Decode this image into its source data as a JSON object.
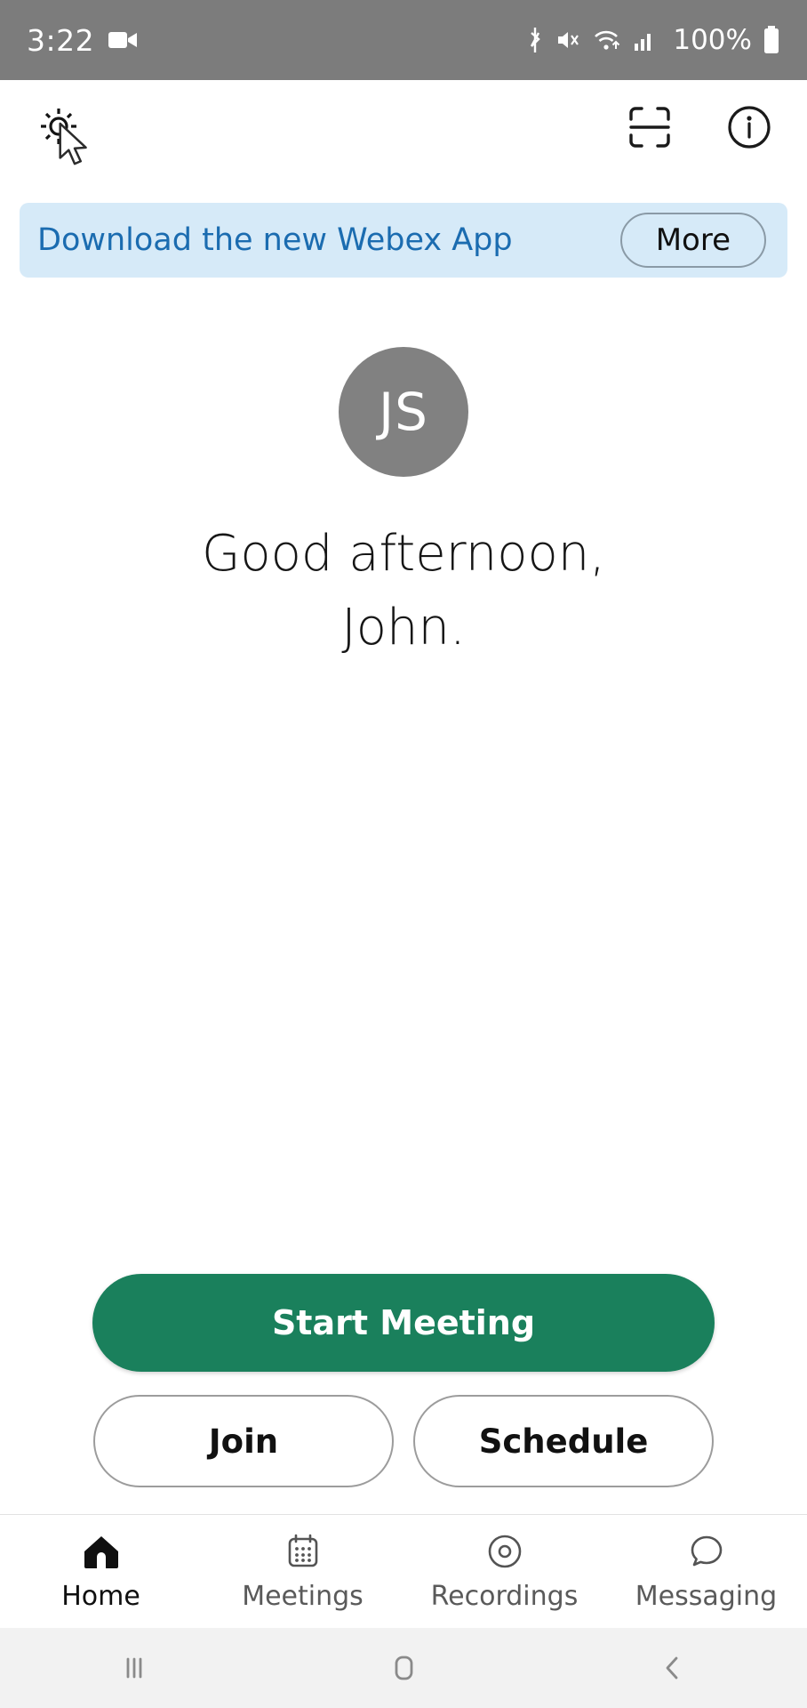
{
  "status_bar": {
    "time": "3:22",
    "battery_text": "100%",
    "icons": [
      "video-camera-icon",
      "bluetooth-icon",
      "mute-icon",
      "wifi-icon",
      "cellular-signal-icon",
      "battery-icon"
    ],
    "background_color": "#7c7c7c"
  },
  "app_bar": {
    "settings_icon": "gear-icon",
    "scan_icon": "qr-scan-icon",
    "info_icon": "info-circle-icon",
    "cursor": "mouse-cursor"
  },
  "banner": {
    "text": "Download the new Webex App",
    "button_label": "More",
    "background_color": "#d6eaf8",
    "text_color": "#1b6cb0"
  },
  "profile": {
    "initials": "JS",
    "avatar_color": "#818181"
  },
  "greeting": {
    "line1": "Good afternoon,",
    "line2": "John."
  },
  "actions": {
    "primary_label": "Start Meeting",
    "primary_color": "#1a805c",
    "join_label": "Join",
    "schedule_label": "Schedule"
  },
  "tabs": [
    {
      "label": "Home",
      "icon": "home-icon",
      "active": true
    },
    {
      "label": "Meetings",
      "icon": "calendar-icon",
      "active": false
    },
    {
      "label": "Recordings",
      "icon": "record-circle-icon",
      "active": false
    },
    {
      "label": "Messaging",
      "icon": "chat-bubble-icon",
      "active": false
    }
  ],
  "system_nav": {
    "recents": "recents-icon",
    "home": "home-square-icon",
    "back": "back-chevron-icon"
  }
}
